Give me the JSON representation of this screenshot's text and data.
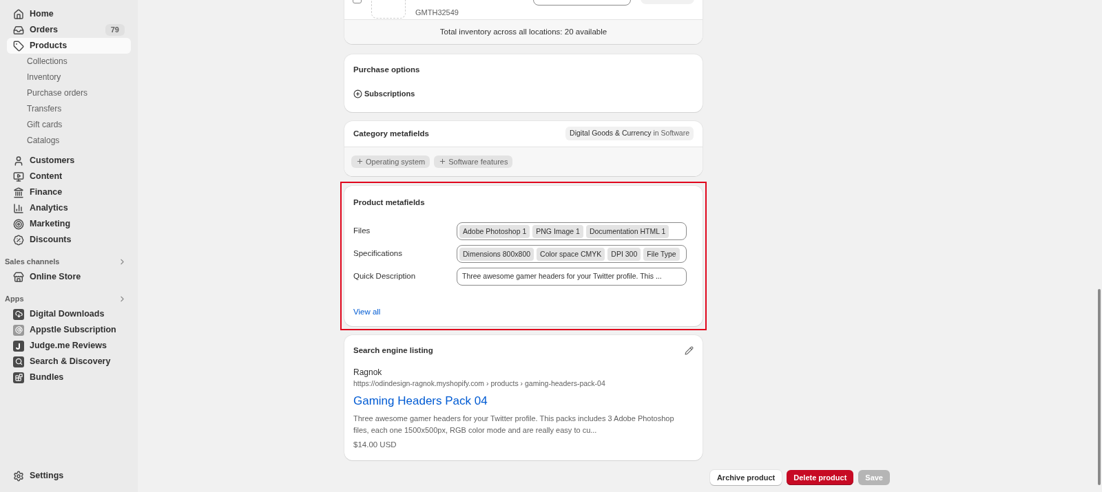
{
  "sidebar": {
    "nav": [
      {
        "label": "Home",
        "selected": false
      },
      {
        "label": "Orders",
        "selected": false,
        "badge": "79"
      },
      {
        "label": "Products",
        "selected": true,
        "children": [
          {
            "label": "Collections",
            "selected": false
          },
          {
            "label": "Inventory",
            "selected": false
          },
          {
            "label": "Purchase orders",
            "selected": false
          },
          {
            "label": "Transfers",
            "selected": false
          },
          {
            "label": "Gift cards",
            "selected": false
          },
          {
            "label": "Catalogs",
            "selected": false
          }
        ]
      },
      {
        "label": "Customers",
        "selected": false
      },
      {
        "label": "Content",
        "selected": false
      },
      {
        "label": "Finance",
        "selected": false
      },
      {
        "label": "Analytics",
        "selected": false
      },
      {
        "label": "Marketing",
        "selected": false
      },
      {
        "label": "Discounts",
        "selected": false
      }
    ],
    "sections": [
      {
        "title": "Sales channels",
        "items": [
          {
            "label": "Online Store",
            "selected": false
          }
        ]
      },
      {
        "title": "Apps",
        "items": [
          {
            "label": "Digital Downloads",
            "selected": false
          },
          {
            "label": "Appstle Subscription",
            "selected": false
          },
          {
            "label": "Judge.me Reviews",
            "selected": false
          },
          {
            "label": "Search & Discovery",
            "selected": false
          },
          {
            "label": "Bundles",
            "selected": false
          }
        ]
      }
    ],
    "settings": {
      "label": "Settings"
    }
  },
  "variant_card": {
    "checked": false,
    "sku": "GMTH32549",
    "total": "Total inventory across all locations: 20 available"
  },
  "purchase_options": {
    "title": "Purchase options",
    "action": "Subscriptions"
  },
  "category_metafields": {
    "title": "Category metafields",
    "category": "Digital Goods & Currency",
    "category_suffix": "in Software",
    "actions": [
      "Operating system",
      "Software features"
    ]
  },
  "product_metafields": {
    "title": "Product metafields",
    "highlighted": true,
    "rows": [
      {
        "label": "Files",
        "kind": "tags",
        "values": [
          "Adobe Photoshop 1",
          "PNG Image 1",
          "Documentation HTML 1"
        ]
      },
      {
        "label": "Specifications",
        "kind": "tags",
        "values": [
          "Dimensions 800x800",
          "Color space CMYK",
          "DPI 300",
          "File Type"
        ]
      },
      {
        "label": "Quick Description",
        "kind": "text",
        "value": "Three awesome gamer headers for your Twitter profile. This ..."
      }
    ],
    "link": "View all"
  },
  "seo": {
    "title": "Search engine listing",
    "store": "Ragnok",
    "url": "https://odindesign-ragnok.myshopify.com › products › gaming-headers-pack-04",
    "page_title": "Gaming Headers Pack 04",
    "description": "Three awesome gamer headers for your Twitter profile. This packs includes 3 Adobe Photoshop files, each one 1500x500px, RGB color mode and are really easy to cu...",
    "price": "$14.00 USD"
  },
  "footer_buttons": [
    {
      "label": "Archive product",
      "kind": "secondary",
      "disabled": false
    },
    {
      "label": "Delete product",
      "kind": "critical",
      "disabled": false
    },
    {
      "label": "Save",
      "kind": "primary",
      "disabled": true
    }
  ]
}
